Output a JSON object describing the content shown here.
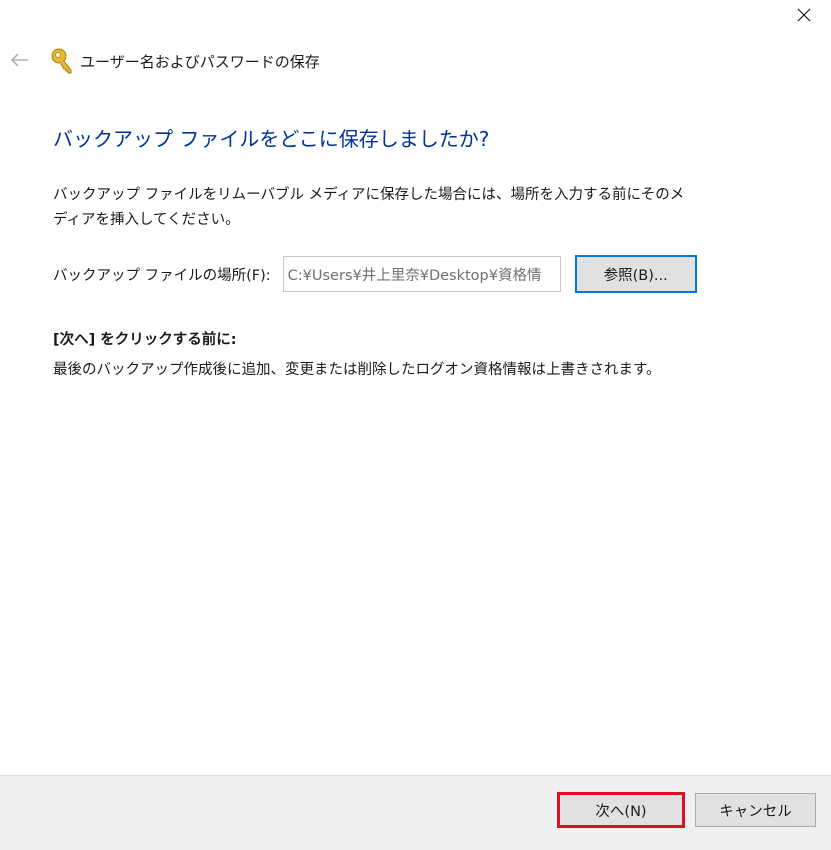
{
  "window": {
    "title": "ユーザー名およびパスワードの保存",
    "close_icon": "close-icon",
    "back_icon": "arrow-left-icon",
    "app_icon": "key-icon"
  },
  "main": {
    "heading": "バックアップ ファイルをどこに保存しましたか?",
    "description": "バックアップ ファイルをリムーバブル メディアに保存した場合には、場所を入力する前にそのメディアを挿入してください。",
    "location_label": "バックアップ ファイルの場所(F):",
    "location_value": "C:¥Users¥井上里奈¥Desktop¥資格情",
    "browse_label": "参照(B)...",
    "note_heading": "[次へ] をクリックする前に:",
    "note_text": "最後のバックアップ作成後に追加、変更または削除したログオン資格情報は上書きされます。"
  },
  "footer": {
    "next_label": "次へ(N)",
    "cancel_label": "キャンセル"
  },
  "colors": {
    "heading": "#003399",
    "accent": "#0078d7",
    "highlight": "#e01020",
    "footer_bg": "#f0f0f0"
  }
}
